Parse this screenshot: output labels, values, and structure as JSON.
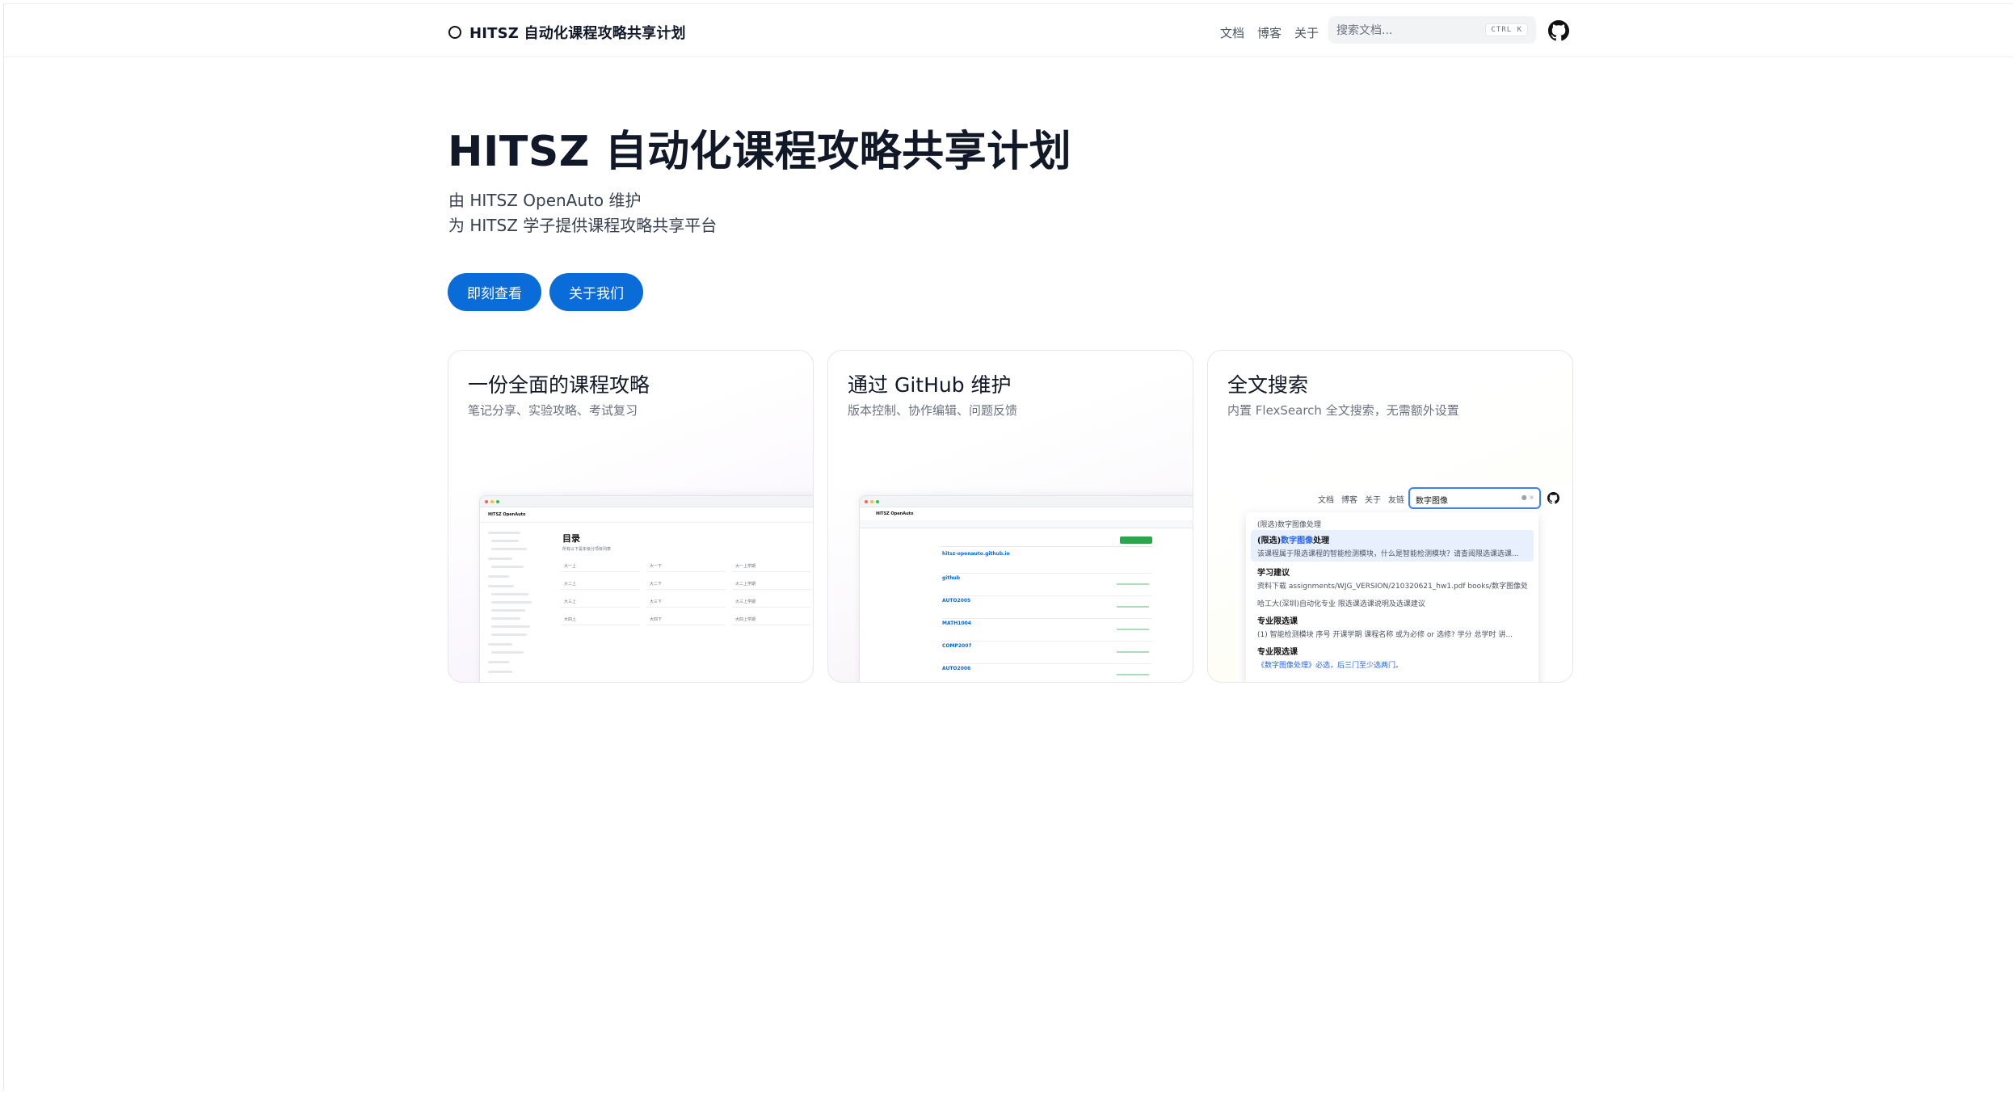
{
  "navbar": {
    "brand": "HITSZ 自动化课程攻略共享计划",
    "links": [
      "文档",
      "博客",
      "关于"
    ],
    "search_placeholder": "搜索文档...",
    "search_shortcut": "CTRL K",
    "github_icon": "github-icon"
  },
  "hero": {
    "title": "HITSZ 自动化课程攻略共享计划",
    "subtitle_line1": "由 HITSZ OpenAuto 维护",
    "subtitle_line2": "为 HITSZ 学子提供课程攻略共享平台",
    "primary_button": "即刻查看",
    "secondary_button": "关于我们",
    "button_color": "#0a6cd9"
  },
  "cards": [
    {
      "title": "一份全面的课程攻略",
      "desc": "笔记分享、实验攻略、考试复习",
      "shot": {
        "site_name": "HITSZ OpenAuto",
        "page_label": "目录",
        "page_hint": "所有以下是年级分项目列表",
        "grid": [
          "大一上",
          "大一下",
          "大一上学期",
          "大二上",
          "大二下",
          "大二上学期",
          "大三上",
          "大三下",
          "大三上学期",
          "大四上",
          "大四下",
          "大四上学期"
        ]
      }
    },
    {
      "title": "通过 GitHub 维护",
      "desc": "版本控制、协作编辑、问题反馈",
      "shot": {
        "org": "HITSZ OpenAuto",
        "repos": [
          "hitsz-openauto.github.io",
          "github",
          "AUTO2005",
          "MATH1004",
          "COMP2007",
          "AUTO2006"
        ]
      }
    },
    {
      "title": "全文搜索",
      "desc": "内置 FlexSearch 全文搜索，无需额外设置",
      "search_demo": {
        "nav": [
          "文档",
          "博客",
          "关于",
          "友链"
        ],
        "query": "数字图像",
        "group1": "(限选)数字图像处理",
        "result1_title": "(限选)数字图像处理",
        "result1_title_pre": "(限选)",
        "result1_title_hl": "数字图像",
        "result1_title_post": "处理",
        "result1_text": "该课程属于限选课程的智能检测模块，什么是智能检测模块？请查阅限选课选课...",
        "result2_title": "学习建议",
        "result2_text": "资料下载 assignments/WJG_VERSION/210320621_hw1.pdf books/数字图像处理...",
        "group2": "哈工大(深圳)自动化专业 限选课选课说明及选课建议",
        "result3_title": "专业限选课",
        "result3_text": "(1) 智能检测模块 序号 开课学期 课程名称 或为必修 or 选修? 学分 总学时 讲...",
        "result4_title": "专业限选课",
        "result4_text": "《数字图像处理》必选，后三门至少选两门。"
      }
    }
  ]
}
